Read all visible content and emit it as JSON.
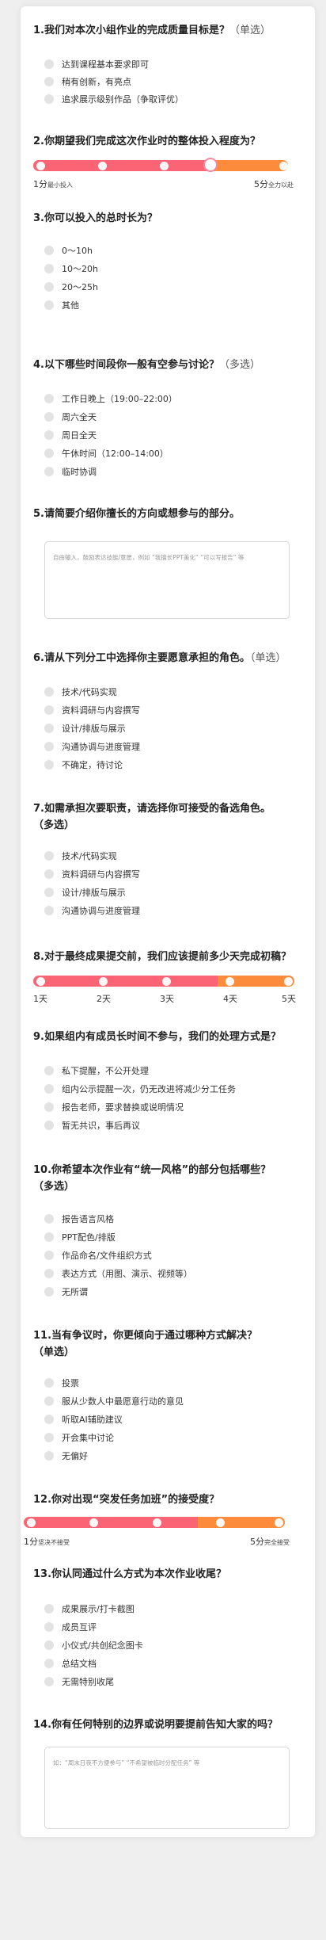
{
  "colors": {
    "pink": "#fa6474",
    "orange": "#fd8b3c",
    "track_gray": "#e3e3e3"
  },
  "q1": {
    "title": "1.我们对本次小组作业的完成质量目标是？",
    "hint": "（单选）",
    "options": [
      "达到课程基本要求即可",
      "稍有创新，有亮点",
      "追求展示级别作品（争取评优）"
    ]
  },
  "q2": {
    "title": "2.你期望我们完成这次作业时的整体投入程度为？",
    "selected_value": 4,
    "min_label": "1分",
    "min_sub": "最小投入",
    "max_label": "5分",
    "max_sub": "全力以赴"
  },
  "q3": {
    "title": "3.你可以投入的总时长为？",
    "options": [
      "0～10h",
      "10～20h",
      "20～25h",
      "其他"
    ]
  },
  "q4": {
    "title": "4.以下哪些时间段你一般有空参与讨论？",
    "hint": "（多选）",
    "options": [
      "工作日晚上（19:00–22:00）",
      "周六全天",
      "周日全天",
      "午休时间（12:00–14:00）",
      "临时协调"
    ]
  },
  "q5": {
    "title": "5.请简要介绍你擅长的方向或想参与的部分。",
    "placeholder": "自由输入，鼓励表达技能/意愿，例如 “我擅长PPT美化” “可以写报告” 等"
  },
  "q6": {
    "title": "6.请从下列分工中选择你主要愿意承担的角色。",
    "hint": "（单选）",
    "options": [
      "技术/代码实现",
      "资料调研与内容撰写",
      "设计/排版与展示",
      "沟通协调与进度管理",
      "不确定，待讨论"
    ]
  },
  "q7": {
    "title": "7.如需承担次要职责，请选择你可接受的备选角色。",
    "title2": "（多选）",
    "options": [
      "技术/代码实现",
      "资料调研与内容撰写",
      "设计/排版与展示",
      "沟通协调与进度管理"
    ]
  },
  "q8": {
    "title": "8.对于最终成果提交前，我们应该提前多少天完成初稿？",
    "labels": [
      "1天",
      "2天",
      "3天",
      "4天",
      "5天"
    ]
  },
  "q9": {
    "title": "9.如果组内有成员长时间不参与，我们的处理方式是？",
    "options": [
      "私下提醒，不公开处理",
      "组内公示提醒一次，仍无改进将减少分工任务",
      "报告老师，要求替换或说明情况",
      "暂无共识，事后再议"
    ]
  },
  "q10": {
    "title": "10.你希望本次作业有“统一风格”的部分包括哪些？",
    "title2": "（多选）",
    "options": [
      "报告语言风格",
      "PPT配色/排版",
      "作品命名/文件组织方式",
      "表达方式（用图、演示、视频等）",
      "无所谓"
    ]
  },
  "q11": {
    "title": "11.当有争议时，你更倾向于通过哪种方式解决？",
    "title2": "（单选）",
    "options": [
      "投票",
      "服从少数人中最愿意行动的意见",
      "听取AI辅助建议",
      "开会集中讨论",
      "无偏好"
    ]
  },
  "q12": {
    "title": "12.你对出现“突发任务加班”的接受度？",
    "min_label": "1分",
    "min_sub": "坚决不接受",
    "max_label": "5分",
    "max_sub": "完全接受"
  },
  "q13": {
    "title": "13.你认同通过什么方式为本次作业收尾？",
    "options": [
      "成果展示/打卡截图",
      "成员互评",
      "小仪式/共创纪念图卡",
      "总结文档",
      "无需特别收尾"
    ]
  },
  "q14": {
    "title": "14.你有任何特别的边界或说明要提前告知大家的吗？",
    "placeholder": "如：“周末日夜不方便参与” “不希望被临时分配任务” 等"
  }
}
